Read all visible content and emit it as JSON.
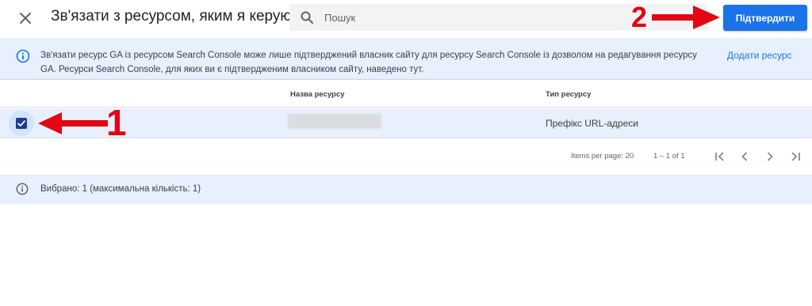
{
  "header": {
    "title": "Зв'язати з ресурсом, яким я керую",
    "search_placeholder": "Пошук",
    "confirm_label": "Підтвердити"
  },
  "info_banner": {
    "text": "Зв'язати ресурс GA із ресурсом Search Console може лише підтверджений власник сайту для ресурсу Search Console із дозволом на редагування ресурсу GA. Ресурси Search Console, для яких ви є підтвердженим власником сайту, наведено тут.",
    "link_label": "Додати ресурс"
  },
  "table": {
    "columns": [
      "Назва ресурсу",
      "Тип ресурсу"
    ],
    "rows": [
      {
        "selected": true,
        "name": "",
        "type": "Префікс URL-адреси"
      }
    ]
  },
  "pagination": {
    "items_per_page": "Items per page: 20",
    "range": "1 – 1 of 1"
  },
  "selection": {
    "text": "Вибрано: 1 (максимальна кількість: 1)"
  },
  "annotations": {
    "step1": "1",
    "step2": "2",
    "arrow_color": "#e30613"
  },
  "colors": {
    "accent": "#1a73e8",
    "highlight_bg": "#e8f0fe",
    "checkbox": "#1a3d8f"
  }
}
